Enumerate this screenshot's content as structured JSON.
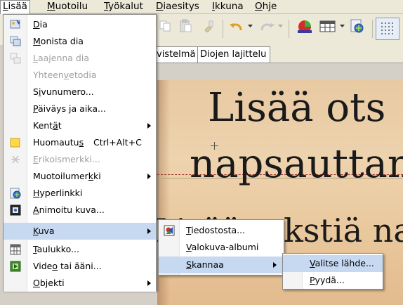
{
  "menubar": {
    "items": [
      {
        "label": "Lisää",
        "u": "L",
        "rest": "isää",
        "active": true
      },
      {
        "label": "Muotoilu",
        "u": "M",
        "rest": "uotoilu"
      },
      {
        "label": "Työkalut",
        "u": "T",
        "rest": "yökalut"
      },
      {
        "label": "Diaesitys",
        "u": "D",
        "rest": "iaesitys"
      },
      {
        "label": "Ikkuna",
        "u": "I",
        "rest": "kkuna"
      },
      {
        "label": "Ohje",
        "u": "O",
        "rest": "hje"
      }
    ]
  },
  "tabs": {
    "partial_label": "vistelmä",
    "sorter_label": "Diojen lajittelu"
  },
  "slide": {
    "title_line1": "Lisää ots",
    "title_line2": "napsauttan",
    "subtitle_line": "Lisää tekstiä napsautta"
  },
  "insert_menu": {
    "items": [
      {
        "pre": "",
        "u": "D",
        "post": "ia",
        "icon": "slide-icon"
      },
      {
        "pre": "",
        "u": "M",
        "post": "onista dia",
        "icon": "duplicate-slide-icon"
      },
      {
        "pre": "",
        "u": "L",
        "post": "aajenna dia",
        "icon": "expand-slide-icon",
        "disabled": true
      },
      {
        "pre": "Yhteen",
        "u": "v",
        "post": "etodia",
        "disabled": true
      },
      {
        "pre": "S",
        "u": "i",
        "post": "vunumero...",
        "icon": ""
      },
      {
        "pre": "",
        "u": "P",
        "post": "äiväys ja aika..."
      },
      {
        "pre": "Kent",
        "u": "ä",
        "post": "t",
        "submenu": true
      },
      {
        "pre": "Huomautu",
        "u": "s",
        "post": "",
        "shortcut": "Ctrl+Alt+C",
        "icon": "note-icon"
      },
      {
        "pre": "",
        "u": "E",
        "post": "rikoismerkki...",
        "icon": "special-character-icon",
        "disabled": true
      },
      {
        "pre": "Muotoilumer",
        "u": "k",
        "post": "ki",
        "submenu": true
      },
      {
        "pre": "",
        "u": "H",
        "post": "yperlinkki",
        "icon": "hyperlink-icon"
      },
      {
        "pre": "",
        "u": "A",
        "post": "nimoitu kuva...",
        "icon": "animated-image-icon"
      },
      {
        "pre": "",
        "u": "K",
        "post": "uva",
        "submenu": true,
        "highlight": true
      },
      {
        "pre": "",
        "u": "T",
        "post": "aulukko...",
        "icon": "table-icon"
      },
      {
        "pre": "Vide",
        "u": "o",
        "post": " tai ääni...",
        "icon": "video-icon"
      },
      {
        "pre": "",
        "u": "O",
        "post": "bjekti",
        "submenu": true
      }
    ]
  },
  "image_submenu": {
    "items": [
      {
        "pre": "",
        "u": "T",
        "post": "iedostosta...",
        "icon": "image-from-file-icon"
      },
      {
        "pre": "",
        "u": "V",
        "post": "alokuva-albumi"
      },
      {
        "pre": "",
        "u": "S",
        "post": "kannaa",
        "submenu": true,
        "highlight": true
      }
    ]
  },
  "scan_submenu": {
    "items": [
      {
        "pre": "",
        "u": "V",
        "post": "alitse lähde...",
        "highlight": true
      },
      {
        "pre": "",
        "u": "P",
        "post": "yydä..."
      }
    ]
  },
  "colors": {
    "menu_highlight": "#c6d9f1",
    "disabled_text": "#a0a0a0",
    "slide_background": "#e9c79c"
  }
}
